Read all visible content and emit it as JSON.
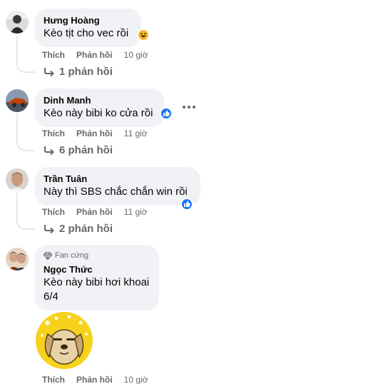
{
  "comments": [
    {
      "author": "Hưng Hoàng",
      "text": "Kèo tịt cho vec rồi",
      "like": "Thích",
      "reply": "Phản hồi",
      "time": "10 giờ",
      "replies": "1 phản hồi",
      "reaction": "haha"
    },
    {
      "author": "Dinh Manh",
      "text": "Kèo này bibi ko cửa rồi",
      "like": "Thích",
      "reply": "Phản hồi",
      "time": "11 giờ",
      "replies": "6 phản hồi",
      "reaction": "like"
    },
    {
      "author": "Trần Tuân",
      "text": "Này thì SBS chắc chắn win rồi",
      "like": "Thích",
      "reply": "Phản hồi",
      "time": "11 giờ",
      "replies": "2 phản hồi",
      "reaction": "like"
    },
    {
      "badge": "Fan cứng",
      "author": "Ngọc Thức",
      "text_line1": "Kèo này bibi hơi khoai",
      "text_line2": "6/4",
      "like": "Thích",
      "reply": "Phản hồi",
      "time": "10 giờ",
      "sticker": "dog-sticker"
    }
  ],
  "colors": {
    "bubble": "#f0f2f5",
    "secondary_text": "#65676b",
    "like_blue": "#1877f2",
    "haha_yellow": "#f7b928"
  }
}
